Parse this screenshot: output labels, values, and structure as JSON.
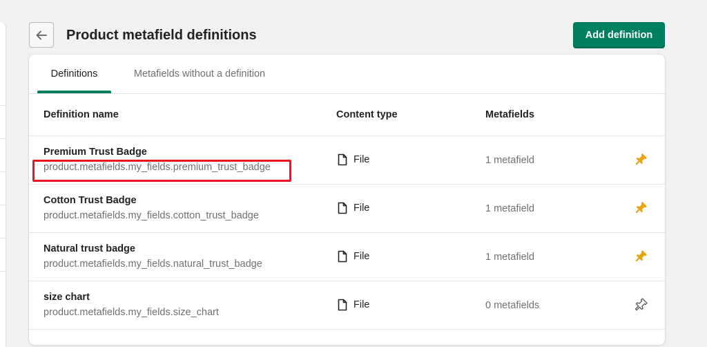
{
  "header": {
    "title": "Product metafield definitions",
    "add_button": "Add definition"
  },
  "tabs": [
    {
      "label": "Definitions",
      "active": true
    },
    {
      "label": "Metafields without a definition",
      "active": false
    }
  ],
  "table": {
    "columns": [
      "Definition name",
      "Content type",
      "Metafields"
    ],
    "rows": [
      {
        "name": "Premium Trust Badge",
        "key": "product.metafields.my_fields.premium_trust_badge",
        "content_type": "File",
        "metafields": "1 metafield",
        "pinned": true
      },
      {
        "name": "Cotton Trust Badge",
        "key": "product.metafields.my_fields.cotton_trust_badge",
        "content_type": "File",
        "metafields": "1 metafield",
        "pinned": true
      },
      {
        "name": "Natural trust badge",
        "key": "product.metafields.my_fields.natural_trust_badge",
        "content_type": "File",
        "metafields": "1 metafield",
        "pinned": true
      },
      {
        "name": "size chart",
        "key": "product.metafields.my_fields.size_chart",
        "content_type": "File",
        "metafields": "0 metafields",
        "pinned": false
      }
    ]
  },
  "colors": {
    "primary": "#008060",
    "pin_active": "#e8a317",
    "pin_inactive": "#5c5f62",
    "highlight": "#e8141e"
  },
  "icons": {
    "back": "arrow-left-icon",
    "file": "file-icon",
    "pin": "pin-icon"
  }
}
